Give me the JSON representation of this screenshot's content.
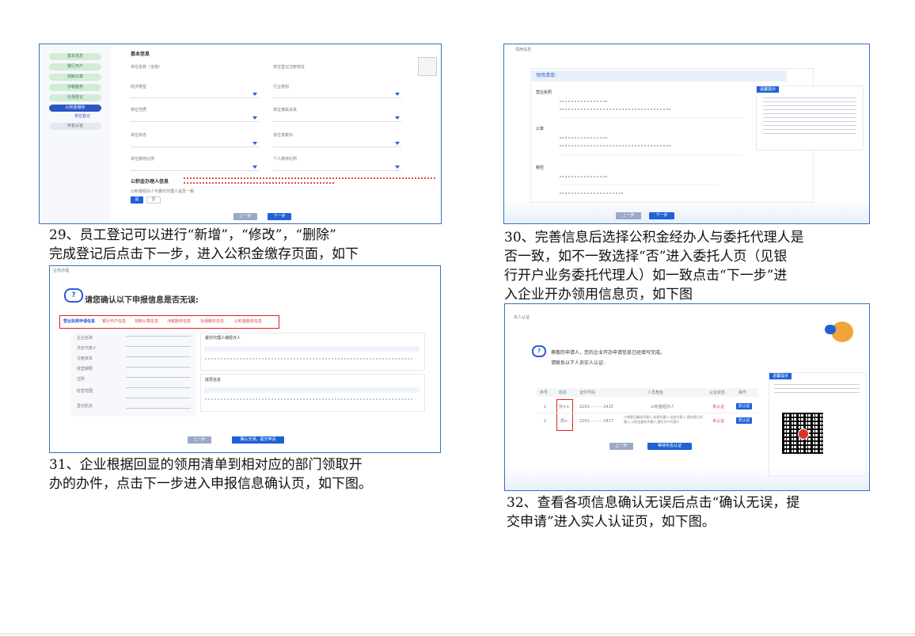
{
  "captions": {
    "c29a": "29、员工登记可以进行“新增”，“修改”，“删除”",
    "c29b": "完成登记后点击下一步，进入公积金缴存页面，如下",
    "c30a": "30、完善信息后选择公积金经办人与委托代理人是",
    "c30b": "否一致，如不一致选择“否”进入委托人页（见银",
    "c30c": "行开户业务委托代理人）如一致点击“下一步”进",
    "c30d": "入企业开办领用信息页，如下图",
    "c31a": "31、企业根据回显的领用清单到相对应的部门领取开",
    "c31b": "办的办件，点击下一步进入申报信息确认页，如下图。",
    "c32a": "32、查看各项信息确认无误后点击“确认无误，提",
    "c32b": "交申请”进入实人认证页，如下图。"
  },
  "s1": {
    "menu": [
      "基本信息",
      "银行开户",
      "刻制公章",
      "涉税服务",
      "社保登记",
      "公积金缴存",
      "实名认证"
    ],
    "submenu": "单位登记",
    "section_title": "基本信息",
    "fields": [
      "单位名称（全称）",
      "单位登记注册地址",
      "经济类型",
      "行业类别",
      "单位性质",
      "单位隶属关系",
      "单位状态",
      "单位发薪日",
      "单位缴存比例",
      "个人缴存比例"
    ],
    "agent_title": "公积金办理人信息",
    "agent_question": "公积金经办人与委托代理人是否一致",
    "yes": "是",
    "no": "否",
    "prev": "上一步",
    "next": "下一步"
  },
  "s2": {
    "crumb": "领用信息",
    "list_title": "领用清单:",
    "groups": [
      "营业执照",
      "公章",
      "税控"
    ],
    "hint_title": "温馨提示",
    "prev": "上一步",
    "next": "下一步"
  },
  "s3": {
    "crumb": "业务办理",
    "title": "请您确认以下申报信息是否无误:",
    "tabs": [
      "营业执照申请信息",
      "银行开户信息",
      "刻制公章信息",
      "涉税服务信息",
      "社保服务信息",
      "公积金服务信息"
    ],
    "left_labels": [
      "企业名称",
      "法定代表人",
      "注册资本",
      "经营期限",
      "住所",
      "经营范围",
      "登记机关"
    ],
    "right_title1": "委托代理人或经办人",
    "right_title2": "成员信息",
    "prev": "上一步",
    "confirm": "确认无误，提交申请"
  },
  "s4": {
    "crumb": "实人认证",
    "msg1": "尊敬的申请人，您的企业开办申请信息已经填写完成。",
    "msg2": "请联系以下人员实人认证:",
    "headers": [
      "序号",
      "姓名",
      "证件号码",
      "人员角色",
      "认证状态",
      "操作"
    ],
    "rows": [
      {
        "no": "1",
        "name": "孙××",
        "id": "2201···········1415",
        "role": "公积金经办人",
        "status": "未认证",
        "op": "去认证"
      },
      {
        "no": "2",
        "name": "周×",
        "id": "2201···········1817",
        "role": "工商登记委托代理人,社保代理人,法定代表人,税务登记代理人,公积金委托代理人,银行开户代理人",
        "status": "未认证",
        "op": "去认证"
      }
    ],
    "hint_title": "温馨提示",
    "prev": "上一步",
    "next": "等待实名认证"
  }
}
